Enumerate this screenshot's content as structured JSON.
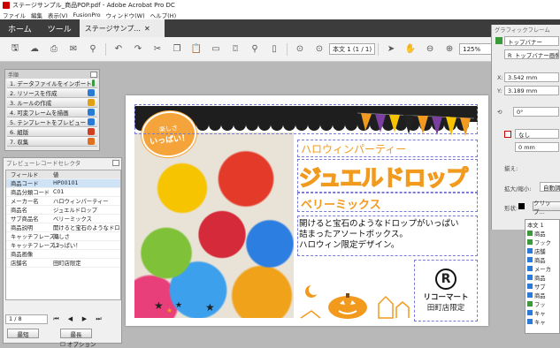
{
  "window_title": "ステージサンプル_商品POP.pdf - Adobe Acrobat Pro DC",
  "menu": [
    "ファイル",
    "編集",
    "表示(V)",
    "FusionPro",
    "ウィンドウ(W)",
    "ヘルプ(H)"
  ],
  "tabs": {
    "home": "ホーム",
    "tools": "ツール",
    "document": "ステージサンプ..."
  },
  "toolbar": {
    "page_current": "本文 1",
    "page_count": "(1 / 1)",
    "zoom": "125%"
  },
  "steps_panel": {
    "title": "手順",
    "items": [
      {
        "label": "1. データファイルをインポート",
        "color": "#3a9a3a"
      },
      {
        "label": "2. リソースを作成",
        "color": "#2a7bd5"
      },
      {
        "label": "3. ルールの作成",
        "color": "#e0a010"
      },
      {
        "label": "4. 可変フレームを描画",
        "color": "#2a7bd5"
      },
      {
        "label": "5. テンプレートをプレビュー",
        "color": "#2a7bd5"
      },
      {
        "label": "6. 組版",
        "color": "#d04020"
      },
      {
        "label": "7. 収集",
        "color": "#e07020"
      }
    ]
  },
  "preview_panel": {
    "title": "プレビューレコードセレクタ",
    "headers": [
      "フィールド",
      "値"
    ],
    "rows": [
      [
        "商品コード",
        "HP00101"
      ],
      [
        "商品分類コード",
        "C01"
      ],
      [
        "メーカー名",
        "ハロウィンパーティー"
      ],
      [
        "商品名",
        "ジュエルドロップ"
      ],
      [
        "サブ商品名",
        "ベリーミックス"
      ],
      [
        "商品説明",
        "開けると宝石のようなドロップがい"
      ],
      [
        "キャッチフレーズ１",
        "楽しさ"
      ],
      [
        "キャッチフレーズ２",
        "いっぱい！"
      ],
      [
        "商品画像",
        ""
      ],
      [
        "店舗名",
        "田町店限定"
      ]
    ],
    "record": "1 / 8",
    "first_btn": "最短",
    "last_btn": "最長",
    "option": "オプション"
  },
  "poster": {
    "bubble_line1": "楽しさ",
    "bubble_line2": "いっぱい！",
    "maker": "ハロウィンパーティー",
    "title": "ジュエルドロップ",
    "subtitle": "ベリーミックス",
    "desc": [
      "開けると宝石のようなドロップがいっぱい",
      "詰まったアソートボックス。",
      "ハロウィン限定デザイン。"
    ],
    "logo_letter": "R",
    "shop_name": "リコーマート",
    "shop_limit": "田町店限定"
  },
  "frame_panel": {
    "title": "グラフィックフレーム",
    "type": "トップバナー",
    "name": "R_トップバナー画像",
    "x_label": "X:",
    "x": "3.542 mm",
    "y_label": "Y:",
    "y": "3.189 mm",
    "rotation": "0°",
    "none": "なし",
    "zero": "0 mm",
    "fit_label": "揃え:",
    "scale_label": "拡大/縮小:",
    "scale": "自動調整",
    "shape_label": "形状:",
    "crop": "クリップ..."
  },
  "field_list": {
    "title": "本文 1",
    "items": [
      "商品",
      "フック",
      "店舗",
      "商品",
      "メーカ",
      "商品",
      "サブ",
      "商品",
      "フッ",
      "キャ",
      "キャ"
    ]
  }
}
